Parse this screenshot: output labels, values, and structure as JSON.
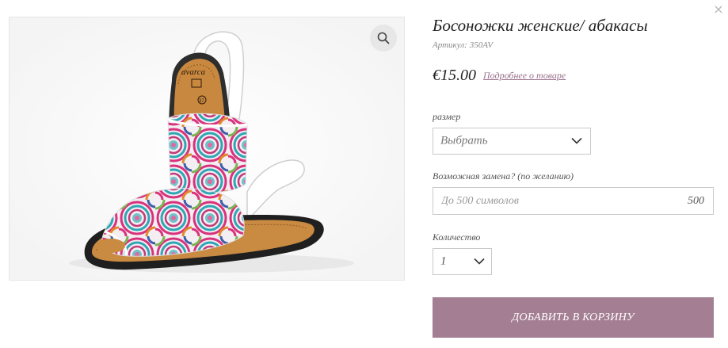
{
  "modal": {
    "close_icon": "close-icon",
    "close_glyph": "×"
  },
  "product": {
    "title": "Босоножки женские/ абакасы",
    "sku_label": "Артикул:",
    "sku_value": "350AV",
    "price": "€15.00",
    "more_link": "Подробнее о товаре",
    "image_icon": "zoom-icon",
    "brand_on_insole": "avarca",
    "size_on_insole": "37"
  },
  "options": {
    "size_label": "размер",
    "size_selected": "Выбрать",
    "replacement_label": "Возможная замена? (по желанию)",
    "replacement_placeholder": "До 500 символов",
    "replacement_value": "",
    "replacement_counter": "500",
    "quantity_label": "Количество",
    "quantity_selected": "1"
  },
  "actions": {
    "add_to_cart": "ДОБАВИТЬ В КОРЗИНУ"
  },
  "colors": {
    "accent": "#a47e92",
    "link": "#9a6f8b",
    "border": "#c9c9c9"
  }
}
